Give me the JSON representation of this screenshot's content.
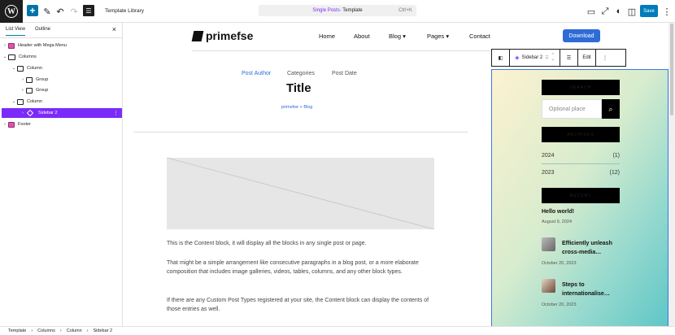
{
  "topbar": {
    "template_library": "Template Library",
    "command": {
      "highlight": "Single Posts",
      "rest": " · Template",
      "shortcut": "Ctrl+K"
    },
    "save_label": "Save"
  },
  "sidebar": {
    "tabs": [
      {
        "label": "List View"
      },
      {
        "label": "Outline"
      }
    ],
    "close": "×",
    "items": [
      {
        "label": "Header with Mega Menu"
      },
      {
        "label": "Columns"
      },
      {
        "label": "Column"
      },
      {
        "label": "Group"
      },
      {
        "label": "Group"
      },
      {
        "label": "Column"
      },
      {
        "label": "Sidebar 2"
      },
      {
        "label": "Footer"
      }
    ]
  },
  "site": {
    "brand": "primefse",
    "nav": [
      "Home",
      "About",
      "Blog ▾",
      "Pages ▾",
      "Contact"
    ],
    "download": "Download"
  },
  "post": {
    "author": "Post Author",
    "categories": "Categories",
    "date": "Post Date",
    "title": "Title",
    "crumb": "primefse > Blog",
    "paragraphs": [
      "This is the Content block, it will display all the blocks in any single post or page.",
      "That might be a simple arrangement like consecutive paragraphs in a blog post, or a more elaborate composition that includes image galleries, videos, tables, columns, and any other block types.",
      "If there are any Custom Post Types registered at your site, the Content block can display the contents of those entries as well."
    ]
  },
  "block_toolbar": {
    "name": "Sidebar 2",
    "edit": "Edit",
    "more": "⋮"
  },
  "side": {
    "search_heading": "SEARCH",
    "search_placeholder": "Optional place",
    "archives_heading": "ARCHIVES",
    "archives": [
      {
        "year": "2024",
        "count": "(1)"
      },
      {
        "year": "2023",
        "count": "(12)"
      }
    ],
    "recent_heading": "RECENT",
    "posts": [
      {
        "title": "Hello world!",
        "date": "August 9, 2024"
      },
      {
        "title": "Efficiently unleash cross-media…",
        "date": "October 20, 2023"
      },
      {
        "title": "Steps to internationalise…",
        "date": "October 20, 2023"
      }
    ]
  },
  "breadcrumb": [
    "Template",
    "Columns",
    "Column",
    "Sidebar 2"
  ],
  "colors": {
    "accent": "#7b2bf9",
    "wp_blue": "#007cba",
    "link": "#2e6bd6"
  }
}
